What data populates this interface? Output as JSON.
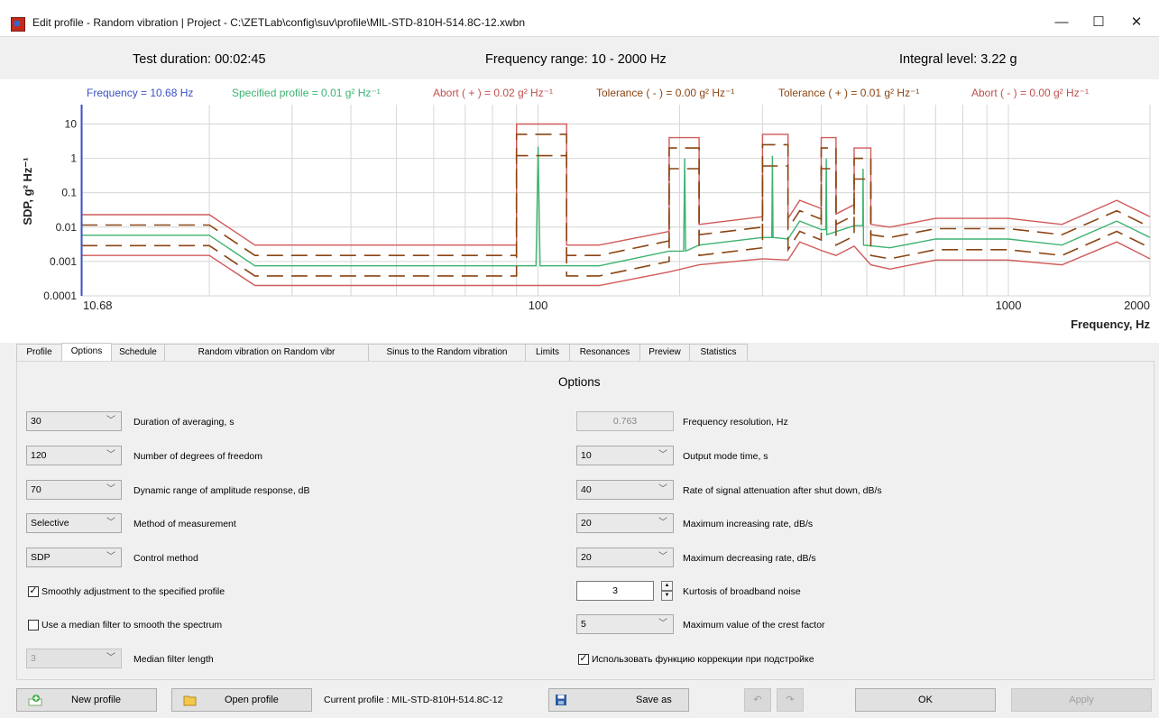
{
  "window": {
    "title": "Edit profile - Random vibration | Project - C:\\ZETLab\\config\\suv\\profile\\MIL-STD-810H-514.8C-12.xwbn",
    "minimize": "—",
    "maximize": "☐",
    "close": "✕"
  },
  "info": {
    "test_duration": "Test duration: 00:02:45",
    "frequency_range": "Frequency range: 10 - 2000  Hz",
    "integral_level": "Integral level: 3.22 g"
  },
  "chart_data": {
    "type": "line",
    "legend": [
      {
        "text": "Frequency = 10.68 Hz",
        "color": "#3a50c8"
      },
      {
        "text": "Specified profile  = 0.01 g² Hz⁻¹",
        "color": "#3cb371"
      },
      {
        "text": "Abort ( + )  = 0.02 g² Hz⁻¹",
        "color": "#c0504d"
      },
      {
        "text": "Tolerance ( - )  = 0.00 g² Hz⁻¹",
        "color": "#8b4513"
      },
      {
        "text": "Tolerance ( + )  = 0.01 g² Hz⁻¹",
        "color": "#8b4513"
      },
      {
        "text": "Abort ( - )  = 0.00 g² Hz⁻¹",
        "color": "#c0504d"
      }
    ],
    "ylabel": "SDP, g² Hz⁻¹",
    "xlabel": "Frequency, Hz",
    "xscale": "log",
    "yscale": "log",
    "xlim": [
      10.68,
      2000
    ],
    "ylim": [
      0.0001,
      20
    ],
    "x_tick_labels": [
      "10.68",
      "100",
      "1000",
      "2000"
    ],
    "x_ticks": [
      10.68,
      100,
      1000,
      2000
    ],
    "y_tick_labels": [
      "0.0001",
      "0.001",
      "0.01",
      "0.1",
      "1",
      "10"
    ],
    "y_ticks": [
      0.0001,
      0.001,
      0.01,
      0.1,
      1,
      10
    ],
    "cursor_x": 10.68,
    "series": [
      {
        "name": "Abort ( + )",
        "color": "#d05a5a",
        "dashed": false,
        "points": [
          [
            10.68,
            0.023
          ],
          [
            20,
            0.023
          ],
          [
            25,
            0.003
          ],
          [
            90,
            0.003
          ],
          [
            90,
            10
          ],
          [
            115,
            10
          ],
          [
            115,
            0.003
          ],
          [
            135,
            0.003
          ],
          [
            190,
            0.0075
          ],
          [
            190,
            4
          ],
          [
            220,
            4
          ],
          [
            220,
            0.012
          ],
          [
            300,
            0.02
          ],
          [
            300,
            5
          ],
          [
            340,
            5
          ],
          [
            340,
            0.018
          ],
          [
            360,
            0.06
          ],
          [
            400,
            0.035
          ],
          [
            400,
            4
          ],
          [
            430,
            4
          ],
          [
            430,
            0.024
          ],
          [
            470,
            0.045
          ],
          [
            470,
            2
          ],
          [
            510,
            2
          ],
          [
            510,
            0.012
          ],
          [
            560,
            0.01
          ],
          [
            700,
            0.018
          ],
          [
            1000,
            0.018
          ],
          [
            1300,
            0.012
          ],
          [
            1700,
            0.06
          ],
          [
            2000,
            0.02
          ]
        ]
      },
      {
        "name": "Tolerance ( + )",
        "color": "#8b4513",
        "dashed": true,
        "points": [
          [
            10.68,
            0.0115
          ],
          [
            20,
            0.0115
          ],
          [
            25,
            0.0015
          ],
          [
            90,
            0.0015
          ],
          [
            90,
            5
          ],
          [
            115,
            5
          ],
          [
            115,
            0.0015
          ],
          [
            135,
            0.0015
          ],
          [
            190,
            0.004
          ],
          [
            190,
            2
          ],
          [
            220,
            2
          ],
          [
            220,
            0.006
          ],
          [
            300,
            0.01
          ],
          [
            300,
            2.5
          ],
          [
            340,
            2.5
          ],
          [
            340,
            0.009
          ],
          [
            360,
            0.03
          ],
          [
            400,
            0.017
          ],
          [
            400,
            2
          ],
          [
            430,
            2
          ],
          [
            430,
            0.012
          ],
          [
            470,
            0.022
          ],
          [
            470,
            1
          ],
          [
            510,
            1
          ],
          [
            510,
            0.006
          ],
          [
            560,
            0.005
          ],
          [
            700,
            0.009
          ],
          [
            1000,
            0.009
          ],
          [
            1300,
            0.006
          ],
          [
            1700,
            0.03
          ],
          [
            2000,
            0.01
          ]
        ]
      },
      {
        "name": "Specified profile",
        "color": "#3cb371",
        "dashed": false,
        "points": [
          [
            10.68,
            0.0058
          ],
          [
            20,
            0.0058
          ],
          [
            25,
            0.00075
          ],
          [
            99,
            0.00075
          ],
          [
            100,
            2.2
          ],
          [
            101,
            0.00075
          ],
          [
            135,
            0.00075
          ],
          [
            190,
            0.002
          ],
          [
            204,
            0.002
          ],
          [
            205,
            1
          ],
          [
            206,
            0.002
          ],
          [
            220,
            0.003
          ],
          [
            300,
            0.005
          ],
          [
            314,
            0.005
          ],
          [
            315,
            1.2
          ],
          [
            316,
            0.005
          ],
          [
            340,
            0.0045
          ],
          [
            360,
            0.015
          ],
          [
            400,
            0.0085
          ],
          [
            409,
            0.0085
          ],
          [
            410,
            1
          ],
          [
            411,
            0.006
          ],
          [
            470,
            0.011
          ],
          [
            490,
            0.011
          ],
          [
            491,
            0.5
          ],
          [
            492,
            0.003
          ],
          [
            560,
            0.0025
          ],
          [
            700,
            0.0045
          ],
          [
            1000,
            0.0045
          ],
          [
            1300,
            0.003
          ],
          [
            1700,
            0.015
          ],
          [
            2000,
            0.005
          ]
        ]
      },
      {
        "name": "Tolerance ( - )",
        "color": "#8b4513",
        "dashed": true,
        "points": [
          [
            10.68,
            0.0029
          ],
          [
            20,
            0.0029
          ],
          [
            25,
            0.00038
          ],
          [
            90,
            0.00038
          ],
          [
            90,
            1.2
          ],
          [
            115,
            1.2
          ],
          [
            115,
            0.00038
          ],
          [
            135,
            0.00038
          ],
          [
            190,
            0.001
          ],
          [
            190,
            0.5
          ],
          [
            220,
            0.5
          ],
          [
            220,
            0.0015
          ],
          [
            300,
            0.0025
          ],
          [
            300,
            0.6
          ],
          [
            340,
            0.6
          ],
          [
            340,
            0.0022
          ],
          [
            360,
            0.0075
          ],
          [
            400,
            0.0042
          ],
          [
            400,
            0.5
          ],
          [
            430,
            0.5
          ],
          [
            430,
            0.003
          ],
          [
            470,
            0.0055
          ],
          [
            470,
            0.25
          ],
          [
            510,
            0.25
          ],
          [
            510,
            0.0015
          ],
          [
            560,
            0.0012
          ],
          [
            700,
            0.0022
          ],
          [
            1000,
            0.0022
          ],
          [
            1300,
            0.0015
          ],
          [
            1700,
            0.0075
          ],
          [
            2000,
            0.0025
          ]
        ]
      },
      {
        "name": "Abort ( - )",
        "color": "#d05a5a",
        "dashed": false,
        "points": [
          [
            10.68,
            0.0015
          ],
          [
            20,
            0.0015
          ],
          [
            25,
            0.0002
          ],
          [
            135,
            0.0002
          ],
          [
            190,
            0.0005
          ],
          [
            220,
            0.0008
          ],
          [
            300,
            0.0012
          ],
          [
            340,
            0.0011
          ],
          [
            360,
            0.0037
          ],
          [
            400,
            0.0021
          ],
          [
            430,
            0.0015
          ],
          [
            470,
            0.0028
          ],
          [
            510,
            0.0008
          ],
          [
            560,
            0.0006
          ],
          [
            700,
            0.0011
          ],
          [
            1000,
            0.0011
          ],
          [
            1300,
            0.0008
          ],
          [
            1700,
            0.0037
          ],
          [
            2000,
            0.0012
          ]
        ]
      }
    ]
  },
  "tabs": [
    "Profile",
    "Options",
    "Schedule",
    "Random vibration on Random vibr",
    "Sinus to the Random vibration",
    "Limits",
    "Resonances",
    "Preview",
    "Statistics"
  ],
  "options": {
    "title": "Options",
    "left": {
      "averaging": {
        "value": "30",
        "label": "Duration of averaging, s"
      },
      "dof": {
        "value": "120",
        "label": "Number of degrees of freedom"
      },
      "dynamic_range": {
        "value": "70",
        "label": "Dynamic range of amplitude response, dB"
      },
      "method": {
        "value": "Selective",
        "label": "Method of measurement"
      },
      "control": {
        "value": "SDP",
        "label": "Control method"
      },
      "smooth_adjust": {
        "checked": "✓",
        "label": "Smoothly adjustment to the specified profile"
      },
      "median_filter": {
        "checked": "",
        "label": "Use a median filter to smooth the spectrum"
      },
      "median_length": {
        "value": "3",
        "label": "Median filter length"
      }
    },
    "right": {
      "freq_resolution": {
        "value": "0.763",
        "label": "Frequency resolution, Hz"
      },
      "output_mode": {
        "value": "10",
        "label": "Output mode time, s"
      },
      "attenuation": {
        "value": "40",
        "label": "Rate of signal attenuation after shut down, dB/s"
      },
      "max_increase": {
        "value": "20",
        "label": "Maximum increasing rate, dB/s"
      },
      "max_decrease": {
        "value": "20",
        "label": "Maximum decreasing rate, dB/s"
      },
      "kurtosis": {
        "value": "3",
        "label": "Kurtosis of broadband noise"
      },
      "crest_factor": {
        "value": "5",
        "label": "Maximum value of the crest factor"
      },
      "correction": {
        "checked": "✓",
        "label": "Использовать функцию коррекции при подстройке"
      }
    }
  },
  "bottom": {
    "new_profile": "New profile",
    "open_profile": "Open profile",
    "current_profile": "Current profile : MIL-STD-810H-514.8C-12",
    "save_as": "Save as",
    "ok": "OK",
    "apply": "Apply"
  }
}
